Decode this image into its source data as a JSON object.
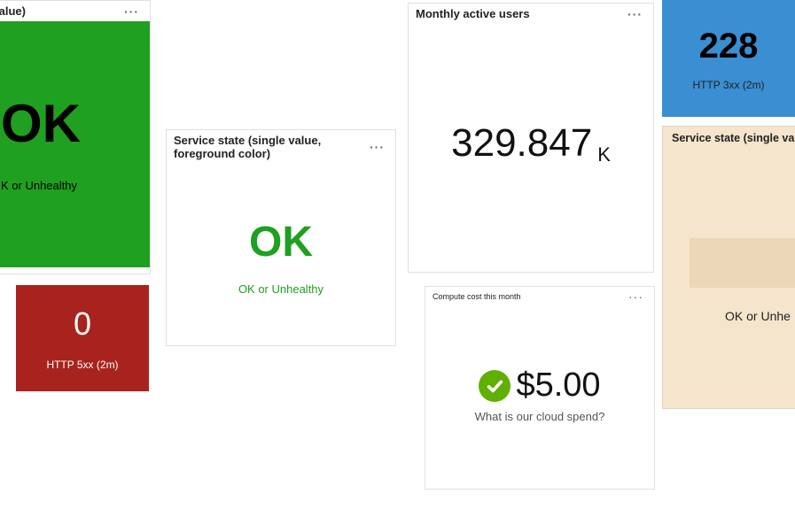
{
  "cards": {
    "greenOk": {
      "title": "gle value)",
      "value": "OK",
      "subtitle": "K or Unhealthy"
    },
    "redZero": {
      "value": "0",
      "subtitle": "HTTP 5xx (2m)"
    },
    "fgOk": {
      "title": "Service state (single value, foreground color)",
      "value": "OK",
      "subtitle": "OK or Unhealthy"
    },
    "mau": {
      "title": "Monthly active users",
      "value": "329.847",
      "unit": "K"
    },
    "cost": {
      "title": "Compute cost this month",
      "value": "$5.00",
      "subtitle": "What is our cloud spend?"
    },
    "blue3xx": {
      "value": "228",
      "subtitle": "HTTP 3xx (2m)"
    },
    "beige": {
      "title": "Service state (single value)",
      "subtitle": "OK or Unhe"
    }
  }
}
